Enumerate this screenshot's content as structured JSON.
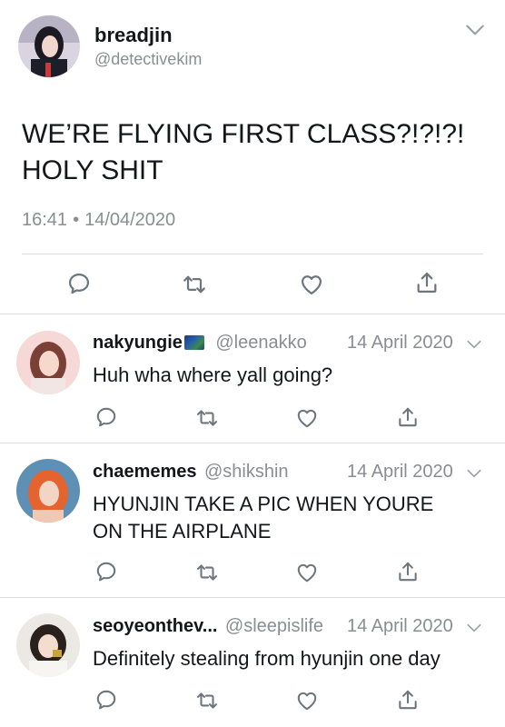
{
  "main_tweet": {
    "display_name": "breadjin",
    "handle": "@detectivekim",
    "text_line1": "WE’RE FLYING FIRST CLASS?!?!?!",
    "text_line2": "HOLY SHIT",
    "time": "16:41",
    "separator": "•",
    "date": "14/04/2020"
  },
  "replies": [
    {
      "display_name": "nakyungie",
      "handle": "@leenakko",
      "date": "14 April 2020",
      "text": "Huh wha where yall going?"
    },
    {
      "display_name": "chaememes",
      "handle": "@shikshin",
      "date": "14 April 2020",
      "text_line1": "HYUNJIN TAKE A PIC WHEN YOURE",
      "text_line2": "ON THE AIRPLANE"
    },
    {
      "display_name": "seoyeonthev...",
      "handle": "@sleepislife",
      "date": "14 April 2020",
      "text": "Definitely stealing from hyunjin one day"
    }
  ],
  "icons": {
    "reply": "reply-icon",
    "retweet": "retweet-icon",
    "like": "heart-icon",
    "share": "share-icon",
    "menu": "chevron-down-icon"
  },
  "colors": {
    "text": "#14171a",
    "muted": "#8a8d91",
    "icon": "#6e767d",
    "divider": "#d9dde0"
  }
}
